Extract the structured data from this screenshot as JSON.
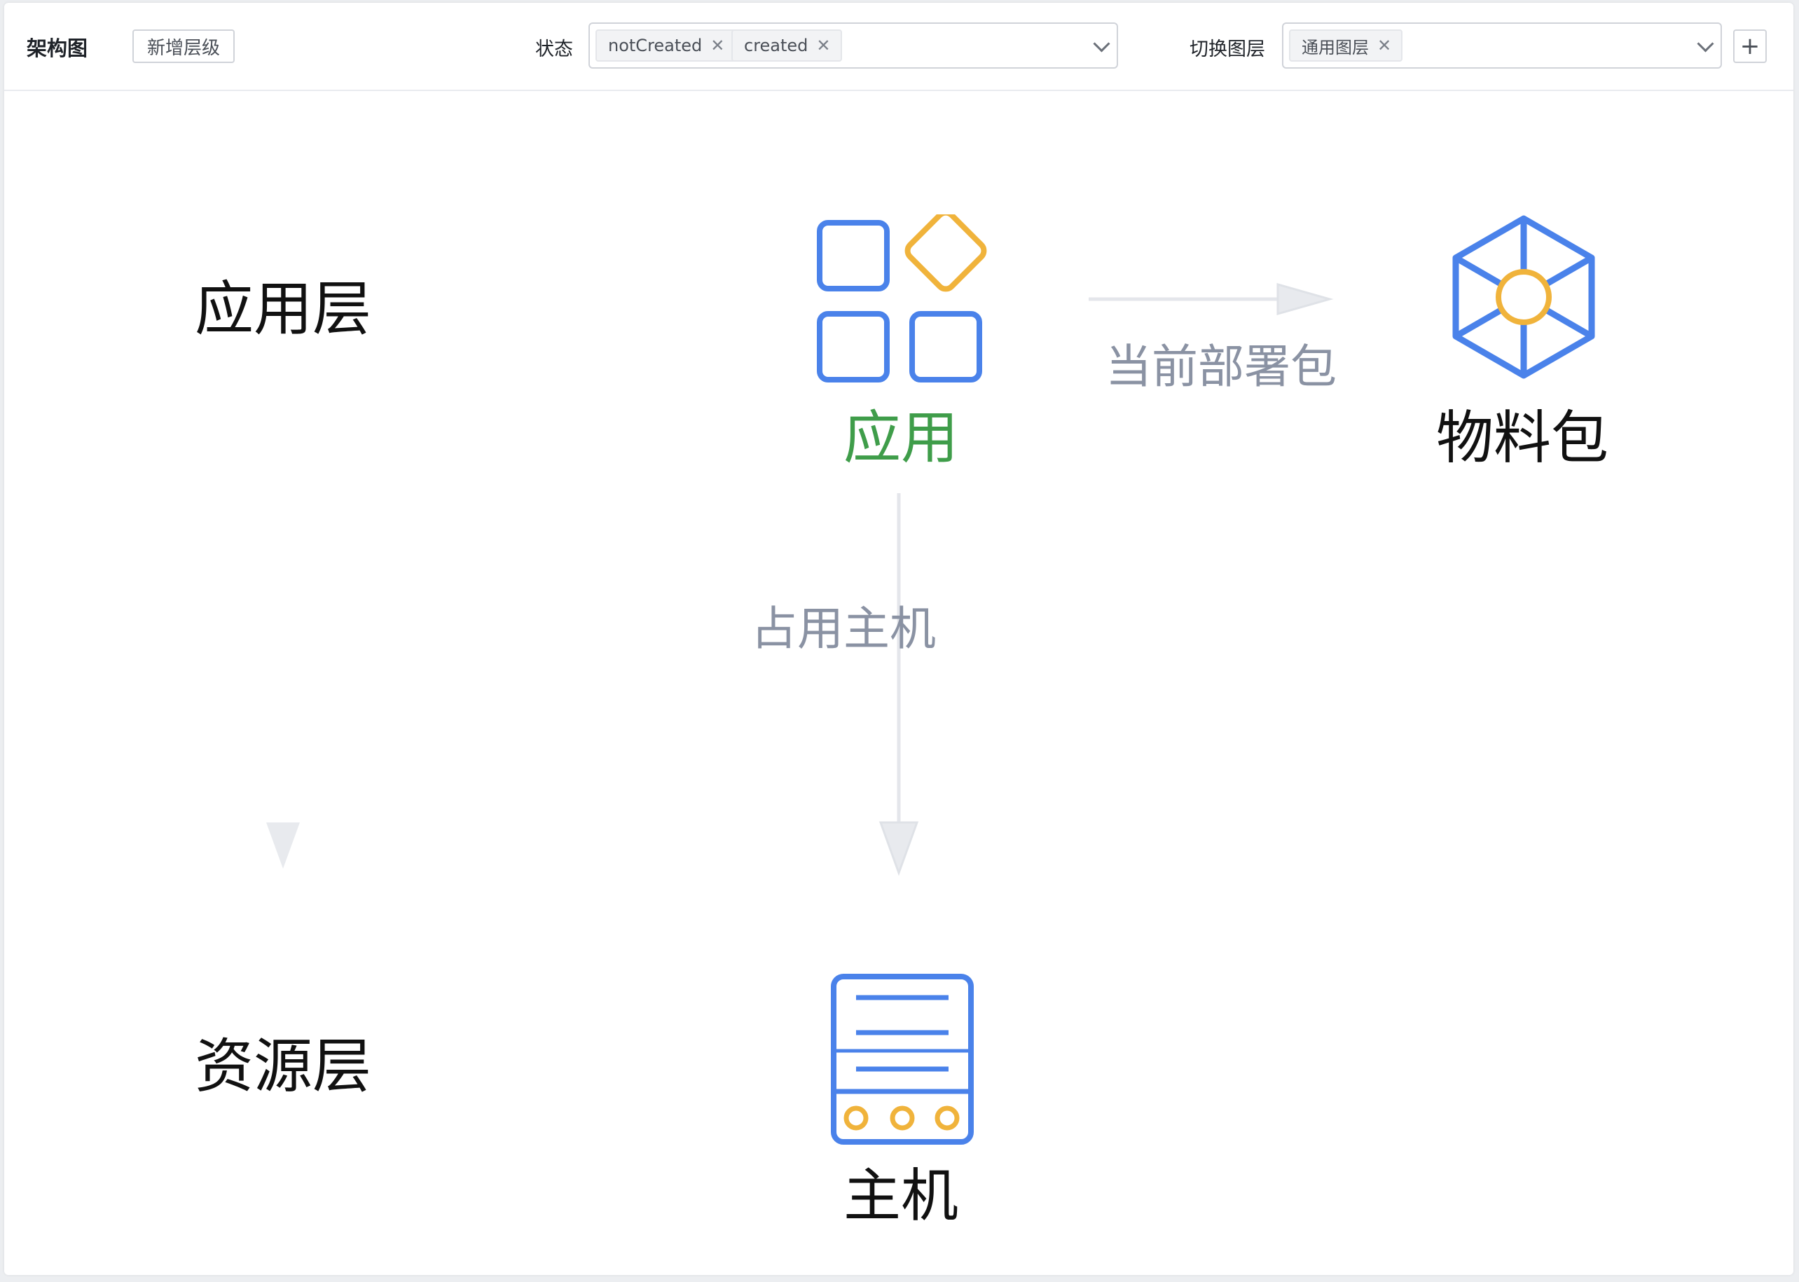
{
  "toolbar": {
    "title": "架构图",
    "add_layer_label": "新增层级",
    "status_label": "状态",
    "status_tags": [
      "notCreated",
      "created"
    ],
    "switch_layer_label": "切换图层",
    "layer_tags": [
      "通用图层"
    ],
    "add_label": "+"
  },
  "diagram": {
    "layers": [
      "应用层",
      "资源层"
    ],
    "nodes": {
      "app": {
        "label": "应用",
        "color": "#3f9d4a"
      },
      "package": {
        "label": "物料包"
      },
      "host": {
        "label": "主机"
      }
    },
    "edges": {
      "app_to_package": "当前部署包",
      "app_to_host": "占用主机"
    },
    "colors": {
      "icon_blue": "#4a82ea",
      "icon_yellow": "#f0b33b",
      "edge": "#e4e6eb",
      "edge_label": "#8a92a3"
    }
  }
}
